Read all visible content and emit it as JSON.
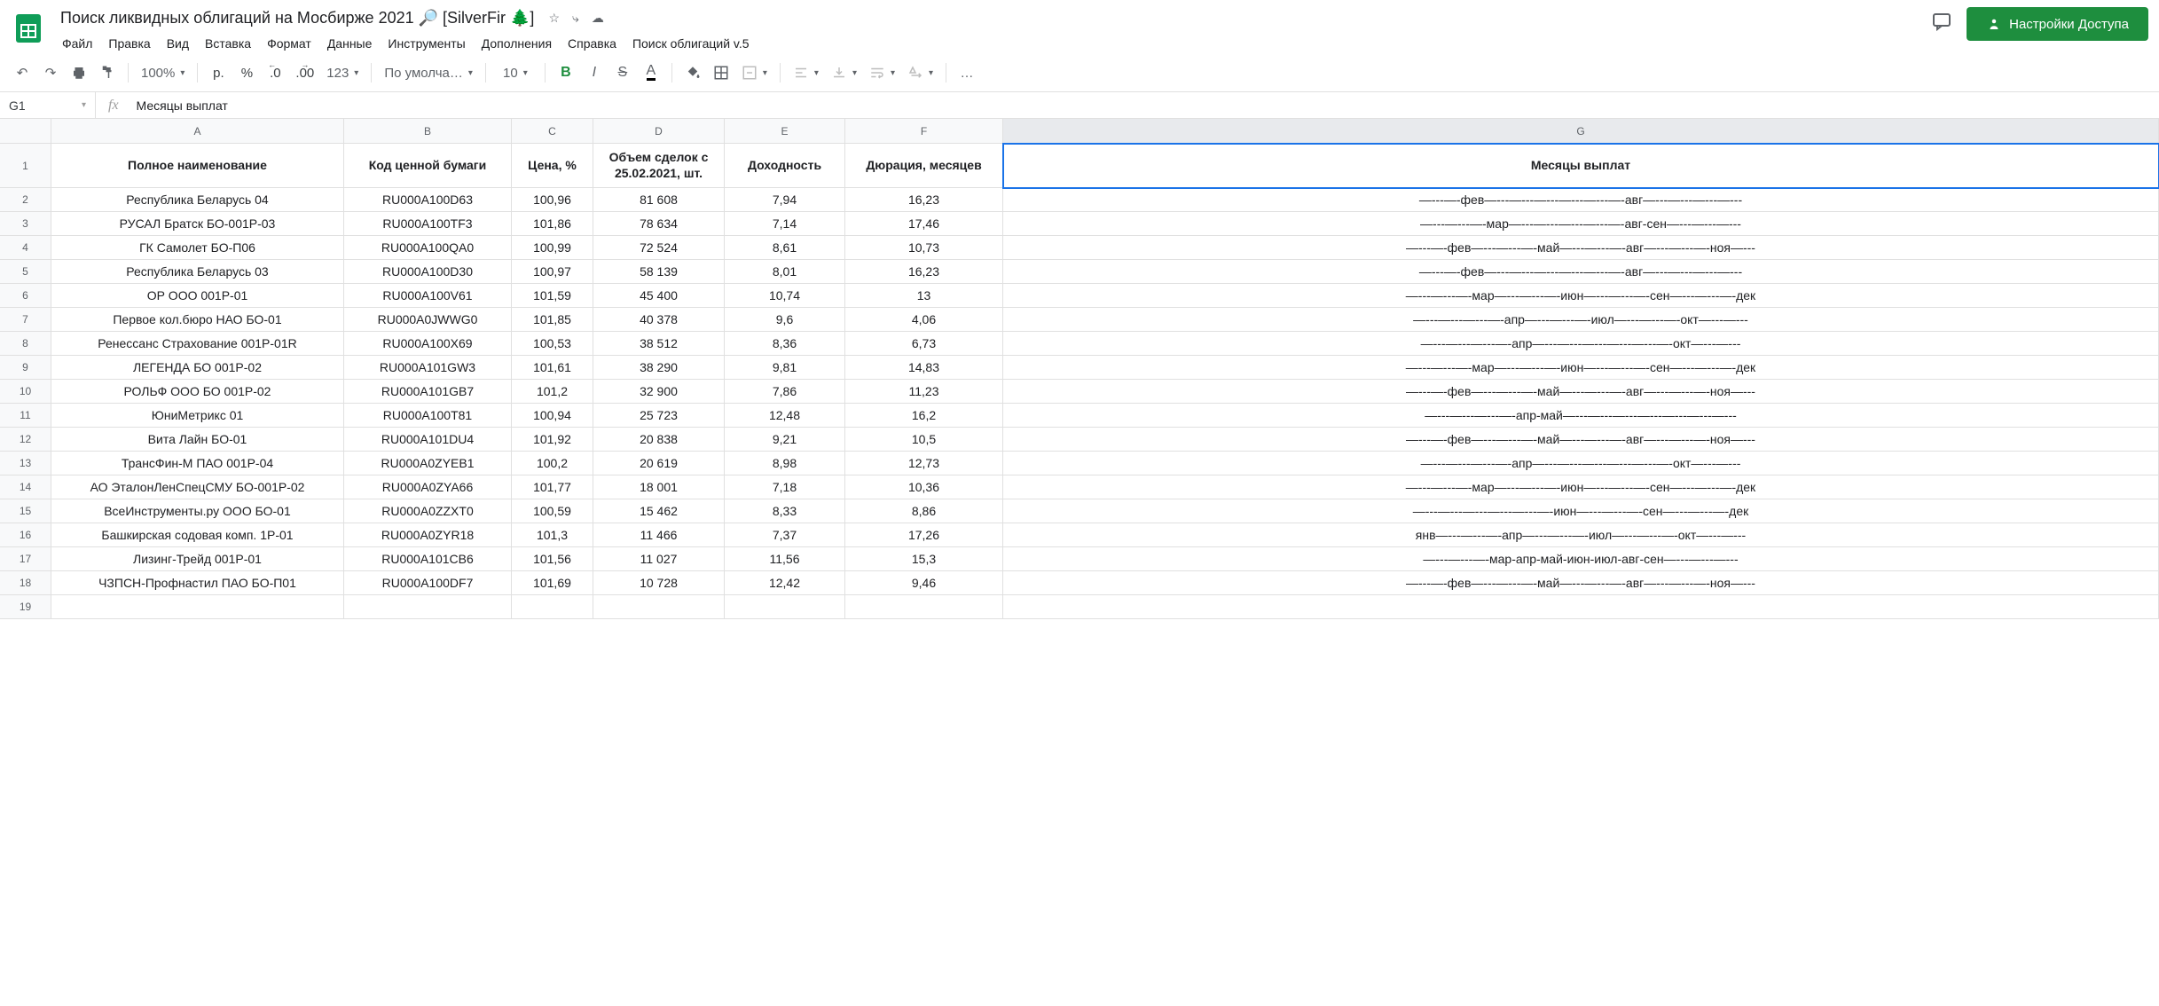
{
  "doc_title": "Поиск ликвидных облигаций на Мосбирже 2021 🔎 [SilverFir 🌲]",
  "share_button": "Настройки Доступа",
  "menus": [
    "Файл",
    "Правка",
    "Вид",
    "Вставка",
    "Формат",
    "Данные",
    "Инструменты",
    "Дополнения",
    "Справка",
    "Поиск облигаций v.5"
  ],
  "toolbar": {
    "zoom": "100%",
    "currency": "р.",
    "percent": "%",
    "dec_dec": ".0",
    "inc_dec": ".00",
    "num_fmt": "123",
    "font": "По умолча…",
    "font_size": "10",
    "more": "…"
  },
  "formula": {
    "cell": "G1",
    "value": "Месяцы выплат"
  },
  "columns": [
    "A",
    "B",
    "C",
    "D",
    "E",
    "F",
    "G"
  ],
  "headers": [
    "Полное наименование",
    "Код ценной бумаги",
    "Цена, %",
    "Объем сделок с 25.02.2021, шт.",
    "Доходность",
    "Дюрация, месяцев",
    "Месяцы выплат"
  ],
  "rows": [
    [
      "Республика Беларусь 04",
      "RU000A100D63",
      "100,96",
      "81 608",
      "7,94",
      "16,23",
      "—---—-фев—---—---—---—---—---—-авг—---—---—---—---"
    ],
    [
      "РУСАЛ Братск БО-001Р-03",
      "RU000A100TF3",
      "101,86",
      "78 634",
      "7,14",
      "17,46",
      "—---—---—-мар—---—---—---—---—-авг-сен—---—---—---"
    ],
    [
      "ГК Самолет БО-П06",
      "RU000A100QA0",
      "100,99",
      "72 524",
      "8,61",
      "10,73",
      "—---—-фев—---—---—-май—---—---—-авг—---—---—-ноя—---"
    ],
    [
      "Республика Беларусь 03",
      "RU000A100D30",
      "100,97",
      "58 139",
      "8,01",
      "16,23",
      "—---—-фев—---—---—---—---—---—-авг—---—---—---—---"
    ],
    [
      "ОР ООО 001P-01",
      "RU000A100V61",
      "101,59",
      "45 400",
      "10,74",
      "13",
      "—---—---—-мар—---—---—-июн—---—---—-сен—---—---—-дек"
    ],
    [
      "Первое кол.бюро НАО БО-01",
      "RU000A0JWWG0",
      "101,85",
      "40 378",
      "9,6",
      "4,06",
      "—---—---—---—-апр—---—---—-июл—---—---—-окт—---—---"
    ],
    [
      "Ренессанс Страхование 001P-01R",
      "RU000A100X69",
      "100,53",
      "38 512",
      "8,36",
      "6,73",
      "—---—---—---—-апр—---—---—---—---—---—-окт—---—---"
    ],
    [
      "ЛЕГЕНДА БО 001Р-02",
      "RU000A101GW3",
      "101,61",
      "38 290",
      "9,81",
      "14,83",
      "—---—---—-мар—---—---—-июн—---—---—-сен—---—---—-дек"
    ],
    [
      "РОЛЬФ ООО БО 001Р-02",
      "RU000A101GB7",
      "101,2",
      "32 900",
      "7,86",
      "11,23",
      "—---—-фев—---—---—-май—---—---—-авг—---—---—-ноя—---"
    ],
    [
      "ЮниМетрикс 01",
      "RU000A100T81",
      "100,94",
      "25 723",
      "12,48",
      "16,2",
      "—---—---—---—-апр-май—---—---—---—---—---—---—---"
    ],
    [
      "Вита Лайн БО-01",
      "RU000A101DU4",
      "101,92",
      "20 838",
      "9,21",
      "10,5",
      "—---—-фев—---—---—-май—---—---—-авг—---—---—-ноя—---"
    ],
    [
      "ТрансФин-М ПАО 001Р-04",
      "RU000A0ZYEB1",
      "100,2",
      "20 619",
      "8,98",
      "12,73",
      "—---—---—---—-апр—---—---—---—---—---—-окт—---—---"
    ],
    [
      "АО ЭталонЛенСпецСМУ БО-001Р-02",
      "RU000A0ZYA66",
      "101,77",
      "18 001",
      "7,18",
      "10,36",
      "—---—---—-мар—---—---—-июн—---—---—-сен—---—---—-дек"
    ],
    [
      "ВсеИнструменты.ру ООО БО-01",
      "RU000A0ZZXT0",
      "100,59",
      "15 462",
      "8,33",
      "8,86",
      "—---—---—---—---—---—-июн—---—---—-сен—---—---—-дек"
    ],
    [
      "Башкирская содовая комп. 1Р-01",
      "RU000A0ZYR18",
      "101,3",
      "11 466",
      "7,37",
      "17,26",
      "янв—---—---—-апр—---—---—-июл—---—---—-окт—---—---"
    ],
    [
      "Лизинг-Трейд 001Р-01",
      "RU000A101CB6",
      "101,56",
      "11 027",
      "11,56",
      "15,3",
      "—---—---—-мар-апр-май-июн-июл-авг-сен—---—---—---"
    ],
    [
      "ЧЗПСН-Профнастил ПАО БО-П01",
      "RU000A100DF7",
      "101,69",
      "10 728",
      "12,42",
      "9,46",
      "—---—-фев—---—---—-май—---—---—-авг—---—---—-ноя—---"
    ]
  ]
}
